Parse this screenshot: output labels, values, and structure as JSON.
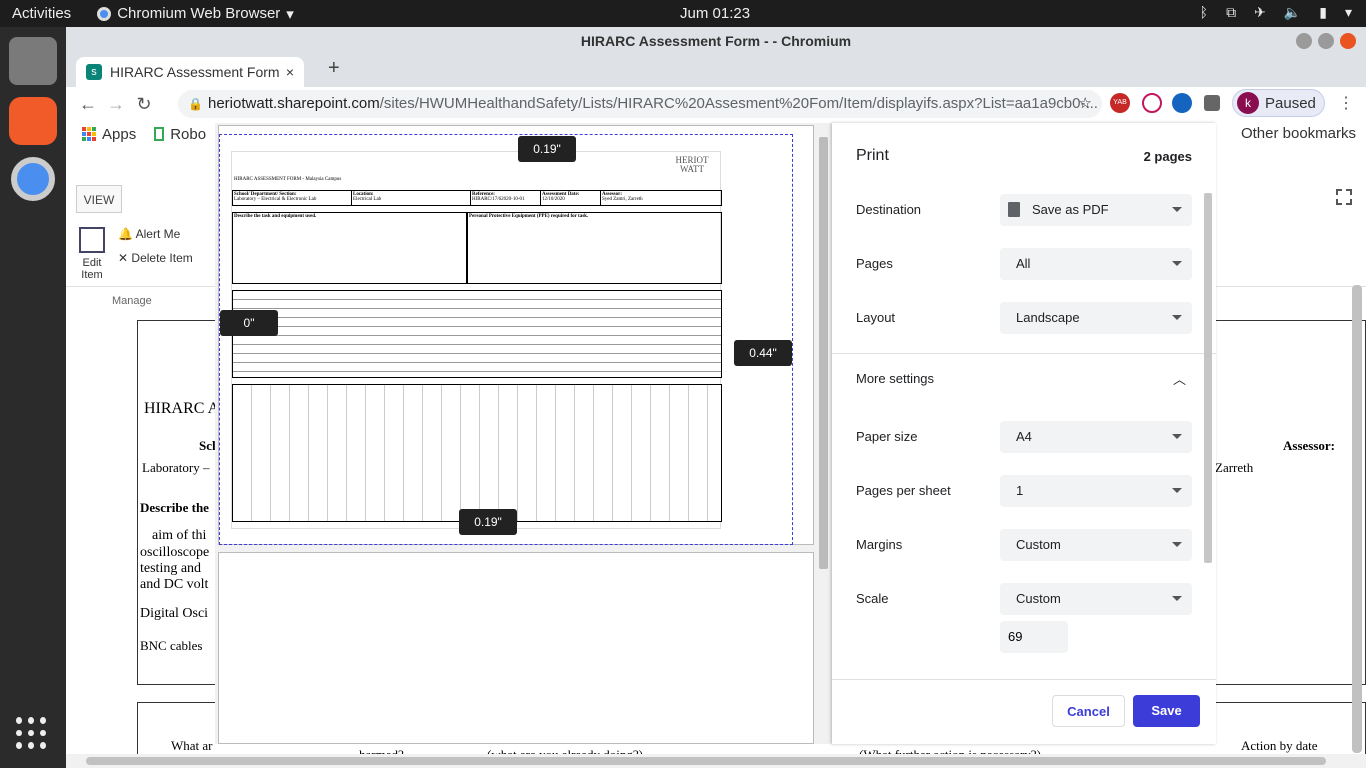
{
  "topbar": {
    "activities": "Activities",
    "app": "Chromium Web Browser",
    "clock": "Jum 01:23"
  },
  "window": {
    "title": "HIRARC Assessment Form - - Chromium"
  },
  "tab": {
    "title": "HIRARC Assessment Form",
    "favicon": "s",
    "close": "×",
    "new": "+"
  },
  "toolbar": {
    "url_host": "heriotwatt.sharepoint.com",
    "url_path": "/sites/HWUMHealthandSafety/Lists/HIRARC%20Assesment%20Fom/Item/displayifs.aspx?List=aa1a9cb0-...",
    "profile_initial": "k",
    "paused_label": "Paused",
    "yab": "YAB"
  },
  "bookmarks": {
    "apps": "Apps",
    "robo": "Robo",
    "other": "Other bookmarks"
  },
  "ribbon": {
    "view": "VIEW",
    "edit_item": "Edit Item",
    "alert_me": "Alert Me",
    "delete_item": "Delete Item",
    "group": "Manage"
  },
  "bgdoc": {
    "title": "HIRARC A",
    "school_head": "Sch",
    "lab": "Laboratory –",
    "describe": "Describe the",
    "l1": "aim of thi",
    "l2": "oscilloscope",
    "l3": "testing and",
    "l4": "and DC volt",
    "digital": "Digital Osci",
    "bnc": "BNC cables",
    "assessor": "Assessor:",
    "zarreth": "Zarreth",
    "what_are": "What ar",
    "harmed": "harmed?",
    "already": "(what are you already doing?)",
    "further": "(What further action is necessary?)",
    "action_by_date": "Action by date"
  },
  "preview": {
    "form_title": "HIRARC ASSESSMENT FORM - Malaysia Campus",
    "logo": "HERIOT WATT",
    "margin_top": "0.19\"",
    "margin_left": "0\"",
    "margin_right": "0.44\"",
    "margin_bottom": "0.19\"",
    "cols": [
      "School/ Department/ Section:",
      "Location:",
      "Reference:",
      "Assessment Date:",
      "Assessor:"
    ],
    "vals": [
      "Laboratory – Electrical & Electronic Lab",
      "Electrical Lab",
      "HIRARC/17/62020-10-01",
      "12/10/2020",
      "Syed Zamri, Zarreth"
    ],
    "describe": "Describe the task and equipment used.",
    "ppe": "Personal Protective Equipment (PPE) required for task."
  },
  "print": {
    "title": "Print",
    "pages_count": "2 pages",
    "destination_label": "Destination",
    "destination": "Save as PDF",
    "pages_label": "Pages",
    "pages": "All",
    "layout_label": "Layout",
    "layout": "Landscape",
    "more": "More settings",
    "paper_label": "Paper size",
    "paper": "A4",
    "pps_label": "Pages per sheet",
    "pps": "1",
    "margins_label": "Margins",
    "margins": "Custom",
    "scale_label": "Scale",
    "scale": "Custom",
    "scale_value": "69",
    "cancel": "Cancel",
    "save": "Save"
  },
  "colors": {
    "accent": "#3c3cd8",
    "topbar": "#1d1d1d",
    "dock": "#2b2b2b"
  }
}
